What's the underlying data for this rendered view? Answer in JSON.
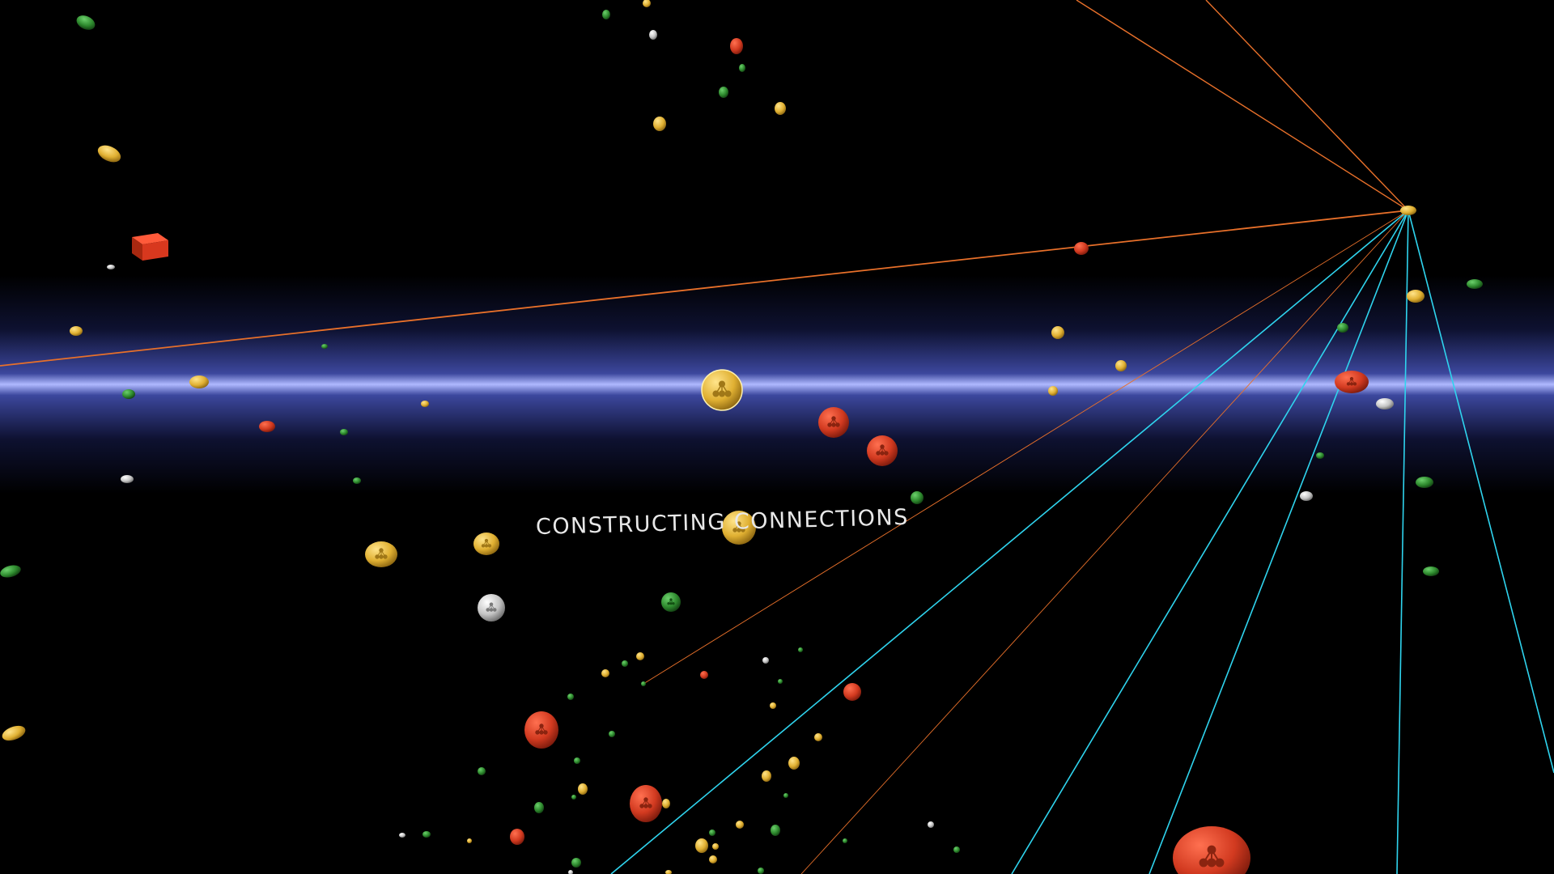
{
  "caption": "CONSTRUCTING CONNECTIONS",
  "colors": {
    "background": "#000000",
    "band_core": "#b8c0ff",
    "orange_line": "#e8702a",
    "cyan_line": "#2fd4ee",
    "node_gold": "#e6b83a",
    "node_red": "#d63a22",
    "node_green": "#2e8a2e",
    "node_silver": "#c8c8c8"
  },
  "nodes": [
    {
      "color": "gold",
      "icon": "network-icon",
      "focus": true
    },
    {
      "color": "red",
      "icon": "network-icon"
    },
    {
      "color": "red",
      "icon": "network-icon"
    },
    {
      "color": "gold",
      "icon": "network-icon"
    },
    {
      "color": "gold",
      "icon": "network-icon"
    },
    {
      "color": "gold",
      "icon": "network-icon"
    },
    {
      "color": "silver",
      "icon": "network-icon"
    },
    {
      "color": "green",
      "icon": "network-icon"
    },
    {
      "color": "red",
      "icon": "network-icon"
    },
    {
      "color": "red",
      "icon": "network-icon"
    },
    {
      "color": "red",
      "icon": "network-icon"
    },
    {
      "color": "red",
      "icon": "network-icon"
    },
    {
      "color": "red",
      "icon": "cube-icon"
    }
  ]
}
